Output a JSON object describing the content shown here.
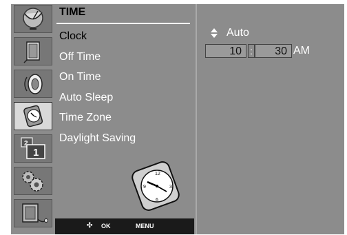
{
  "menu": {
    "title": "TIME",
    "items": [
      {
        "label": "Clock"
      },
      {
        "label": "Off Time"
      },
      {
        "label": "On Time"
      },
      {
        "label": "Auto Sleep"
      },
      {
        "label": "Time Zone"
      },
      {
        "label": "Daylight Saving"
      }
    ],
    "selected_index": 0
  },
  "footer": {
    "nav_icon": "four-way-arrow-icon",
    "ok_label": "OK",
    "menu_label": "MENU"
  },
  "clock_setting": {
    "mode": "Auto",
    "hour": "10",
    "separator": ":",
    "minute": "30",
    "ampm": "AM"
  },
  "icons": [
    "satellite-dish-icon",
    "picture-icon",
    "speaker-icon",
    "clock-icon",
    "pip-icon",
    "gears-icon",
    "input-icon"
  ],
  "selected_icon": "clock-icon",
  "colors": {
    "panel_bg": "#8c8c8c",
    "footer_bg": "#1a1a1a",
    "text_white": "#ffffff",
    "selected_text": "#000000"
  }
}
